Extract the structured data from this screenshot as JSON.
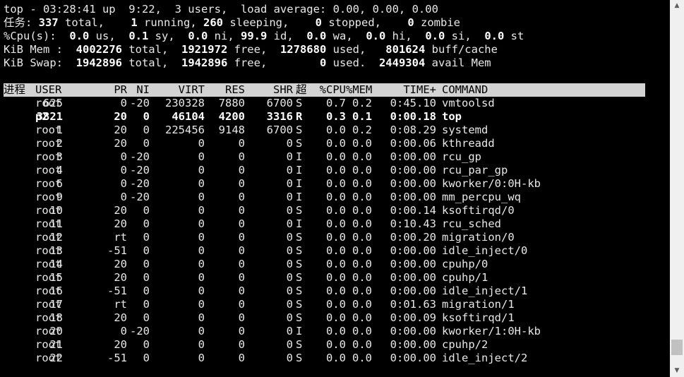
{
  "summary": {
    "l1": {
      "text": "top - 03:28:41 up  9:22,  3 users,  load average: 0.00, 0.00, 0.00"
    },
    "l2": {
      "a": "任务: ",
      "total": "337",
      "b": " total,    ",
      "running": "1",
      "c": " running, ",
      "sleeping": "260",
      "d": " sleeping,    ",
      "stopped": "0",
      "e": " stopped,    ",
      "zombie": "0",
      "f": " zombie"
    },
    "l3": {
      "a": "%Cpu(s):  ",
      "us": "0.0",
      "b": " us,  ",
      "sy": "0.1",
      "c": " sy,  ",
      "ni": "0.0",
      "d": " ni, ",
      "id": "99.9",
      "e": " id,  ",
      "wa": "0.0",
      "f": " wa,  ",
      "hi": "0.0",
      "g": " hi,  ",
      "si": "0.0",
      "h": " si,  ",
      "st": "0.0",
      "i": " st"
    },
    "l4": {
      "a": "KiB Mem :  ",
      "total": "4002276",
      "b": " total,  ",
      "free": "1921972",
      "c": " free,  ",
      "used": "1278680",
      "d": " used,   ",
      "buff": "801624",
      "e": " buff/cache"
    },
    "l5": {
      "a": "KiB Swap:  ",
      "total": "1942896",
      "b": " total,  ",
      "free": "1942896",
      "c": " free,        ",
      "used": "0",
      "d": " used.  ",
      "avail": "2449304",
      "e": " avail Mem"
    }
  },
  "columns": {
    "pid": "进程",
    "user": "USER",
    "pr": "PR",
    "ni": "NI",
    "virt": "VIRT",
    "res": "RES",
    "shr": "SHR",
    "s": "超",
    "cpu": "%CPU",
    "mem": "%MEM",
    "time": "TIME+",
    "command": "COMMAND"
  },
  "processes": [
    {
      "pid": "625",
      "user": "root",
      "pr": "0",
      "ni": "-20",
      "virt": "230328",
      "res": "7880",
      "shr": "6700",
      "s": "S",
      "cpu": "0.7",
      "mem": "0.2",
      "time": "0:45.10",
      "command": "vmtoolsd"
    },
    {
      "pid": "3821",
      "user": "p2",
      "pr": "20",
      "ni": "0",
      "virt": "46104",
      "res": "4200",
      "shr": "3316",
      "s": "R",
      "cpu": "0.3",
      "mem": "0.1",
      "time": "0:00.18",
      "command": "top"
    },
    {
      "pid": "1",
      "user": "root",
      "pr": "20",
      "ni": "0",
      "virt": "225456",
      "res": "9148",
      "shr": "6700",
      "s": "S",
      "cpu": "0.0",
      "mem": "0.2",
      "time": "0:08.29",
      "command": "systemd"
    },
    {
      "pid": "2",
      "user": "root",
      "pr": "20",
      "ni": "0",
      "virt": "0",
      "res": "0",
      "shr": "0",
      "s": "S",
      "cpu": "0.0",
      "mem": "0.0",
      "time": "0:00.06",
      "command": "kthreadd"
    },
    {
      "pid": "3",
      "user": "root",
      "pr": "0",
      "ni": "-20",
      "virt": "0",
      "res": "0",
      "shr": "0",
      "s": "I",
      "cpu": "0.0",
      "mem": "0.0",
      "time": "0:00.00",
      "command": "rcu_gp"
    },
    {
      "pid": "4",
      "user": "root",
      "pr": "0",
      "ni": "-20",
      "virt": "0",
      "res": "0",
      "shr": "0",
      "s": "I",
      "cpu": "0.0",
      "mem": "0.0",
      "time": "0:00.00",
      "command": "rcu_par_gp"
    },
    {
      "pid": "6",
      "user": "root",
      "pr": "0",
      "ni": "-20",
      "virt": "0",
      "res": "0",
      "shr": "0",
      "s": "I",
      "cpu": "0.0",
      "mem": "0.0",
      "time": "0:00.00",
      "command": "kworker/0:0H-kb"
    },
    {
      "pid": "9",
      "user": "root",
      "pr": "0",
      "ni": "-20",
      "virt": "0",
      "res": "0",
      "shr": "0",
      "s": "I",
      "cpu": "0.0",
      "mem": "0.0",
      "time": "0:00.00",
      "command": "mm_percpu_wq"
    },
    {
      "pid": "10",
      "user": "root",
      "pr": "20",
      "ni": "0",
      "virt": "0",
      "res": "0",
      "shr": "0",
      "s": "S",
      "cpu": "0.0",
      "mem": "0.0",
      "time": "0:00.14",
      "command": "ksoftirqd/0"
    },
    {
      "pid": "11",
      "user": "root",
      "pr": "20",
      "ni": "0",
      "virt": "0",
      "res": "0",
      "shr": "0",
      "s": "I",
      "cpu": "0.0",
      "mem": "0.0",
      "time": "0:10.43",
      "command": "rcu_sched"
    },
    {
      "pid": "12",
      "user": "root",
      "pr": "rt",
      "ni": "0",
      "virt": "0",
      "res": "0",
      "shr": "0",
      "s": "S",
      "cpu": "0.0",
      "mem": "0.0",
      "time": "0:00.20",
      "command": "migration/0"
    },
    {
      "pid": "13",
      "user": "root",
      "pr": "-51",
      "ni": "0",
      "virt": "0",
      "res": "0",
      "shr": "0",
      "s": "S",
      "cpu": "0.0",
      "mem": "0.0",
      "time": "0:00.00",
      "command": "idle_inject/0"
    },
    {
      "pid": "14",
      "user": "root",
      "pr": "20",
      "ni": "0",
      "virt": "0",
      "res": "0",
      "shr": "0",
      "s": "S",
      "cpu": "0.0",
      "mem": "0.0",
      "time": "0:00.00",
      "command": "cpuhp/0"
    },
    {
      "pid": "15",
      "user": "root",
      "pr": "20",
      "ni": "0",
      "virt": "0",
      "res": "0",
      "shr": "0",
      "s": "S",
      "cpu": "0.0",
      "mem": "0.0",
      "time": "0:00.00",
      "command": "cpuhp/1"
    },
    {
      "pid": "16",
      "user": "root",
      "pr": "-51",
      "ni": "0",
      "virt": "0",
      "res": "0",
      "shr": "0",
      "s": "S",
      "cpu": "0.0",
      "mem": "0.0",
      "time": "0:00.00",
      "command": "idle_inject/1"
    },
    {
      "pid": "17",
      "user": "root",
      "pr": "rt",
      "ni": "0",
      "virt": "0",
      "res": "0",
      "shr": "0",
      "s": "S",
      "cpu": "0.0",
      "mem": "0.0",
      "time": "0:01.63",
      "command": "migration/1"
    },
    {
      "pid": "18",
      "user": "root",
      "pr": "20",
      "ni": "0",
      "virt": "0",
      "res": "0",
      "shr": "0",
      "s": "S",
      "cpu": "0.0",
      "mem": "0.0",
      "time": "0:00.09",
      "command": "ksoftirqd/1"
    },
    {
      "pid": "20",
      "user": "root",
      "pr": "0",
      "ni": "-20",
      "virt": "0",
      "res": "0",
      "shr": "0",
      "s": "I",
      "cpu": "0.0",
      "mem": "0.0",
      "time": "0:00.00",
      "command": "kworker/1:0H-kb"
    },
    {
      "pid": "21",
      "user": "root",
      "pr": "20",
      "ni": "0",
      "virt": "0",
      "res": "0",
      "shr": "0",
      "s": "S",
      "cpu": "0.0",
      "mem": "0.0",
      "time": "0:00.00",
      "command": "cpuhp/2"
    },
    {
      "pid": "22",
      "user": "root",
      "pr": "-51",
      "ni": "0",
      "virt": "0",
      "res": "0",
      "shr": "0",
      "s": "S",
      "cpu": "0.0",
      "mem": "0.0",
      "time": "0:00.00",
      "command": "idle_inject/2"
    }
  ],
  "highlighted_process_index": 1,
  "scrollbar": {
    "up_arrow": "▲",
    "down_arrow": "▼",
    "position_fraction": 0.97
  },
  "colors": {
    "background": "#000000",
    "text": "#e8e8e8",
    "header_bar": "#d3d3d3",
    "header_text": "#000000",
    "scrollbar_track": "#f0f0f0"
  }
}
